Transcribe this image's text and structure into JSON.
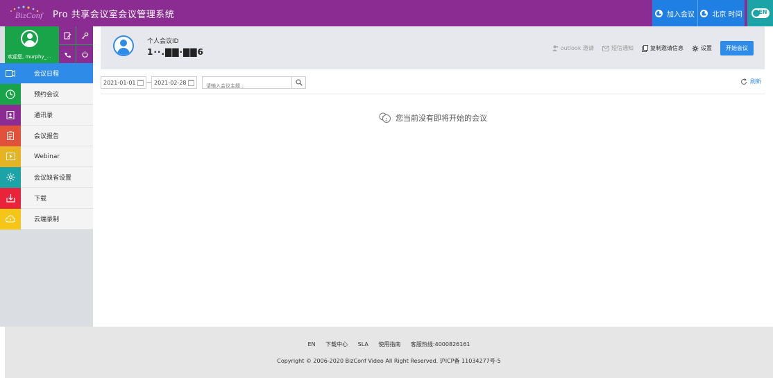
{
  "header": {
    "logo_text": "BizConf",
    "app_title": "Pro 共享会议室会议管理系统",
    "join_label": "加入会议",
    "time_label": "北京 时间",
    "lang_label": "EN"
  },
  "user": {
    "welcome": "欢迎您, murphy_..."
  },
  "sidebar": {
    "items": [
      {
        "label": "会议日程",
        "icon": "camera-icon",
        "color": "#2f8be8"
      },
      {
        "label": "预约会议",
        "icon": "clock-icon",
        "color": "#1aa44a"
      },
      {
        "label": "通讯录",
        "icon": "contacts-icon",
        "color": "#8b2c92"
      },
      {
        "label": "会议报告",
        "icon": "report-icon",
        "color": "#e0533a"
      },
      {
        "label": "Webinar",
        "icon": "webinar-icon",
        "color": "#e6b422"
      },
      {
        "label": "会议缺省设置",
        "icon": "gear-icon",
        "color": "#1ba3a8"
      },
      {
        "label": "下载",
        "icon": "download-icon",
        "color": "#e8233a"
      },
      {
        "label": "云端录制",
        "icon": "cloud-icon",
        "color": "#f5c518"
      }
    ]
  },
  "meeting_id": {
    "label": "个人会议ID",
    "value": "1··.▇▇·▇▇6"
  },
  "actions": {
    "outlook": "outlook 邀请",
    "sms": "短信通知",
    "copy": "复制邀请信息",
    "settings": "设置",
    "start": "开始会议"
  },
  "filter": {
    "start_date": "2021-01-01",
    "end_date": "2021-02-28",
    "dash": "—",
    "search_placeholder": "请输入会议主题...",
    "refresh": "刷新"
  },
  "empty_message": "您当前没有即将开始的会议",
  "footer": {
    "links": [
      "EN",
      "下载中心",
      "SLA",
      "使用指南",
      "客服热线:4000826161"
    ],
    "copyright": "Copyright © 2006-2020 BizConf Video All Right Reserved. 沪ICP备 11034277号-5"
  }
}
